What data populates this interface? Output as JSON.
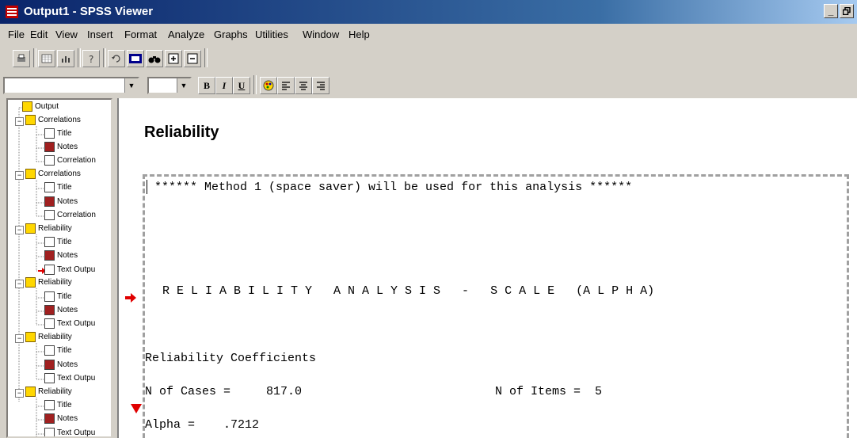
{
  "window": {
    "title": "Output1 - SPSS Viewer",
    "minimize": "_",
    "restore": " "
  },
  "menu": [
    "File",
    "Edit",
    "View",
    "Insert",
    "Format",
    "Analyze",
    "Graphs",
    "Utilities",
    "Window",
    "Help"
  ],
  "format_bar": {
    "bold": "B",
    "italic": "I",
    "underline": "U"
  },
  "tree": {
    "root": "Output",
    "nodes": [
      {
        "label": "Correlations",
        "children": [
          "Title",
          "Notes",
          "Correlation"
        ]
      },
      {
        "label": "Correlations",
        "children": [
          "Title",
          "Notes",
          "Correlation"
        ]
      },
      {
        "label": "Reliability",
        "children": [
          "Title",
          "Notes",
          "Text Outpu"
        ]
      },
      {
        "label": "Reliability",
        "children": [
          "Title",
          "Notes",
          "Text Outpu"
        ]
      },
      {
        "label": "Reliability",
        "children": [
          "Title",
          "Notes",
          "Text Outpu"
        ]
      },
      {
        "label": "Reliability",
        "children": [
          "Title",
          "Notes",
          "Text Outpu"
        ]
      }
    ]
  },
  "viewer": {
    "heading": "Reliability",
    "lines": {
      "method": "****** Method 1 (space saver) will be used for this analysis ******",
      "analysis_title": "R E L I A B I L I T Y   A N A L Y S I S   -   S C A L E   (A L P H A)",
      "coefficients": "Reliability Coefficients",
      "n_cases": "N of Cases =     817.0",
      "n_items": "N of Items =  5",
      "alpha": "Alpha =    .7212"
    }
  },
  "colors": {
    "title_start": "#0a246a",
    "title_end": "#a6caf0",
    "arrow": "#e00000"
  }
}
